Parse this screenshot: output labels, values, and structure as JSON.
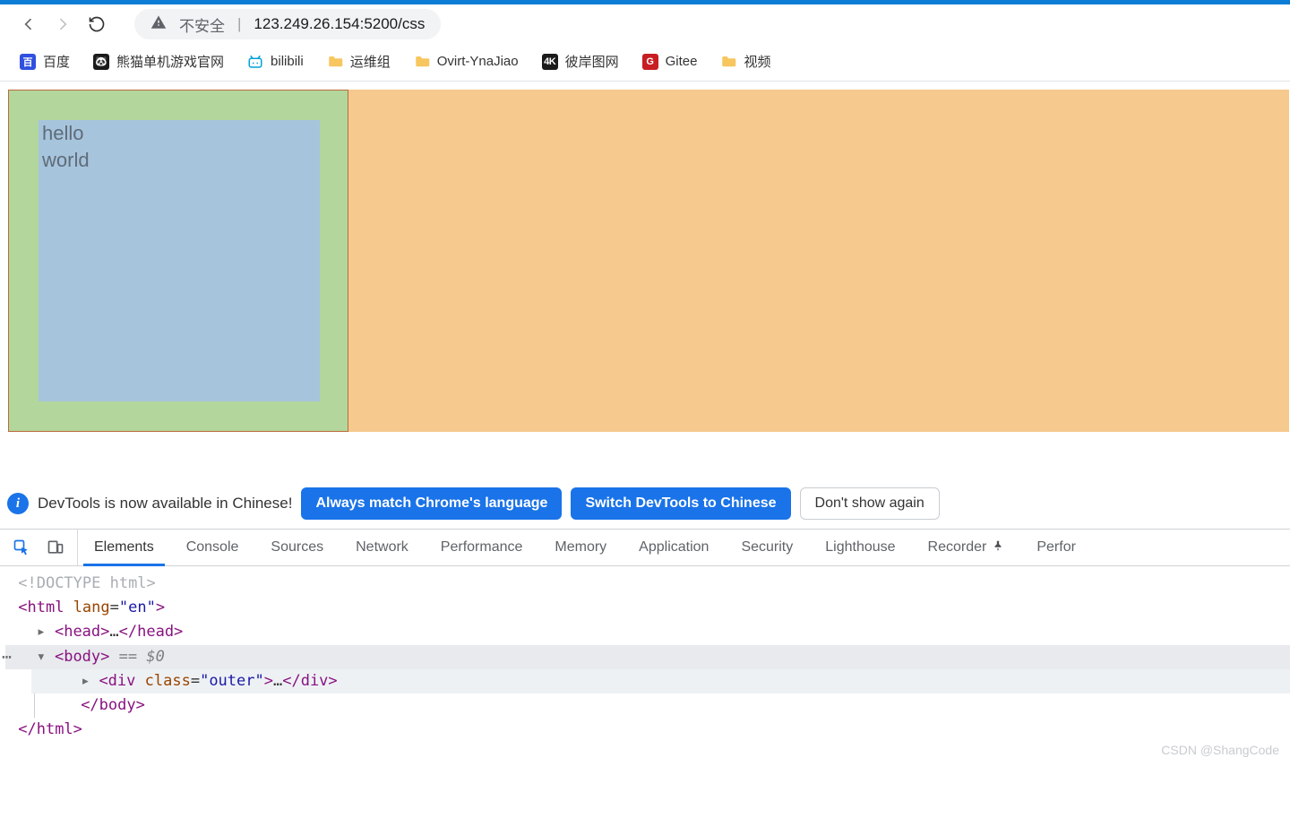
{
  "browser": {
    "warning_label": "不安全",
    "url": "123.249.26.154:5200/css"
  },
  "bookmarks": [
    {
      "label": "百度"
    },
    {
      "label": "熊猫单机游戏官网"
    },
    {
      "label": "bilibili"
    },
    {
      "label": "运维组"
    },
    {
      "label": "Ovirt-YnaJiao"
    },
    {
      "label": "彼岸图网"
    },
    {
      "label": "Gitee"
    },
    {
      "label": "视频"
    }
  ],
  "page": {
    "hello": "hello",
    "world": "world"
  },
  "lang_bar": {
    "msg": "DevTools is now available in Chinese!",
    "btn_always": "Always match Chrome's language",
    "btn_switch": "Switch DevTools to Chinese",
    "btn_dont": "Don't show again"
  },
  "devtools_tabs": {
    "elements": "Elements",
    "console": "Console",
    "sources": "Sources",
    "network": "Network",
    "performance": "Performance",
    "memory": "Memory",
    "application": "Application",
    "security": "Security",
    "lighthouse": "Lighthouse",
    "recorder": "Recorder",
    "last": "Perfor"
  },
  "elements_panel": {
    "doctype": "<!DOCTYPE html>",
    "html_open": "<html lang=\"en\">",
    "head_line": "▸ <head>…</head>",
    "body_open": "<body>",
    "body_marker": " == $0",
    "div_line": "▸ <div class=\"outer\">…</div>",
    "body_close": "</body>",
    "html_close": "</html>"
  },
  "watermark": "CSDN @ShangCode"
}
